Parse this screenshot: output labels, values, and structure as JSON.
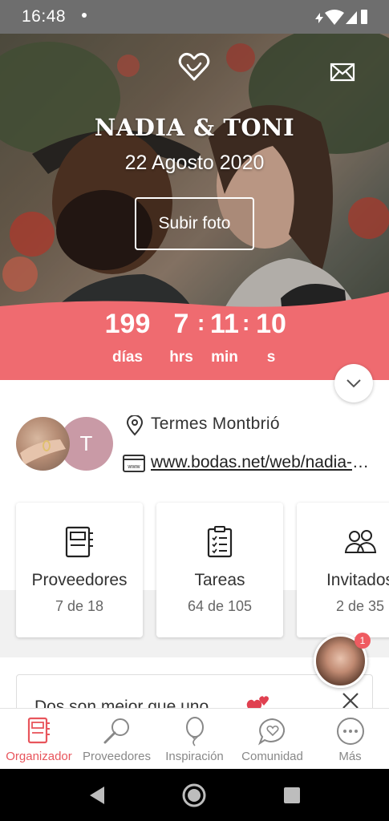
{
  "status_bar": {
    "time": "16:48"
  },
  "hero": {
    "names": "NADIA & TONI",
    "date": "22 Agosto 2020",
    "upload_button": "Subir foto"
  },
  "countdown": {
    "days": "199",
    "days_label": "días",
    "hours": "7",
    "hours_label": "hrs",
    "minutes": "11",
    "minutes_label": "min",
    "seconds": "10",
    "seconds_label": "s"
  },
  "info": {
    "avatar_initial": "T",
    "location": "Termes Montbrió",
    "website": "www.bodas.net/web/nadia-y-toni"
  },
  "cards": [
    {
      "title": "Proveedores",
      "count": "7 de 18",
      "icon": "notebook-icon"
    },
    {
      "title": "Tareas",
      "count": "64 de 105",
      "icon": "checklist-icon"
    },
    {
      "title": "Invitados",
      "count": "2 de 35",
      "icon": "guests-icon"
    }
  ],
  "tip": {
    "text": "Dos son mejor que uno"
  },
  "assistant": {
    "badge": "1"
  },
  "bottom_nav": [
    {
      "label": "Organizador",
      "icon": "notebook-icon",
      "active": true
    },
    {
      "label": "Proveedores",
      "icon": "search-icon",
      "active": false
    },
    {
      "label": "Inspiración",
      "icon": "balloon-icon",
      "active": false
    },
    {
      "label": "Comunidad",
      "icon": "chat-heart-icon",
      "active": false
    },
    {
      "label": "Más",
      "icon": "more-icon",
      "active": false
    }
  ],
  "colors": {
    "accent": "#ef6b70",
    "active_nav": "#e8555c",
    "avatar_bg": "#c99aa6"
  }
}
